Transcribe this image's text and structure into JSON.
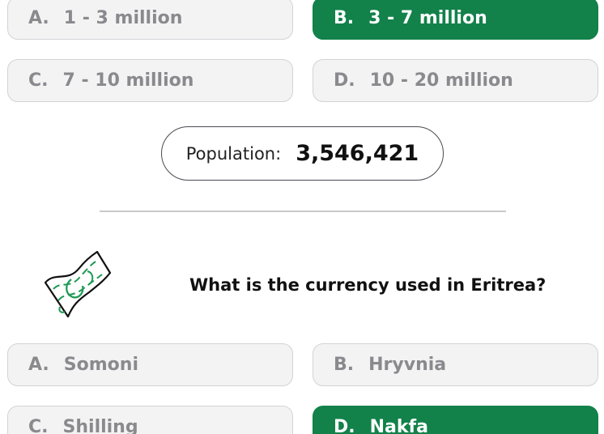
{
  "q1": {
    "options": [
      {
        "letter": "A.",
        "text": "1 - 3 million"
      },
      {
        "letter": "B.",
        "text": "3 - 7 million"
      },
      {
        "letter": "C.",
        "text": "7 - 10 million"
      },
      {
        "letter": "D.",
        "text": "10 - 20 million"
      }
    ]
  },
  "population": {
    "label": "Population:",
    "value": "3,546,421"
  },
  "q2": {
    "icon": "banknote-icon",
    "question": "What is the currency used in Eritrea?",
    "options": [
      {
        "letter": "A.",
        "text": "Somoni"
      },
      {
        "letter": "B.",
        "text": "Hryvnia"
      },
      {
        "letter": "C.",
        "text": "Shilling"
      },
      {
        "letter": "D.",
        "text": "Nakfa"
      }
    ]
  },
  "colors": {
    "correct": "#12814a",
    "option_bg": "#f3f3f4",
    "option_text": "#8a8a8e"
  }
}
